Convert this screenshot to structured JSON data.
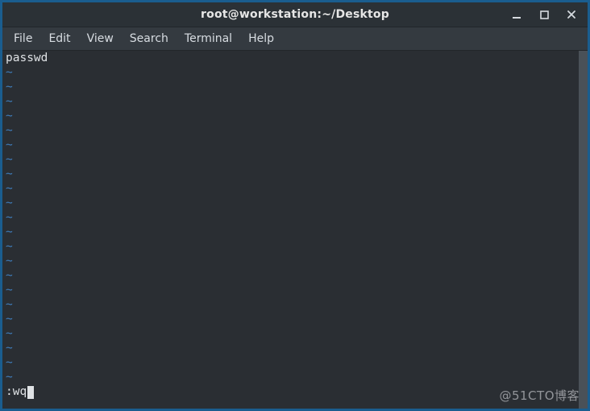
{
  "window": {
    "title": "root@workstation:~/Desktop"
  },
  "menubar": {
    "items": [
      "File",
      "Edit",
      "View",
      "Search",
      "Terminal",
      "Help"
    ]
  },
  "terminal": {
    "content_line": "passwd",
    "empty_line_marker": "~",
    "empty_line_count": 22,
    "command_prefix": ":",
    "command_text": "wq"
  },
  "watermark": "@51CTO博客"
}
